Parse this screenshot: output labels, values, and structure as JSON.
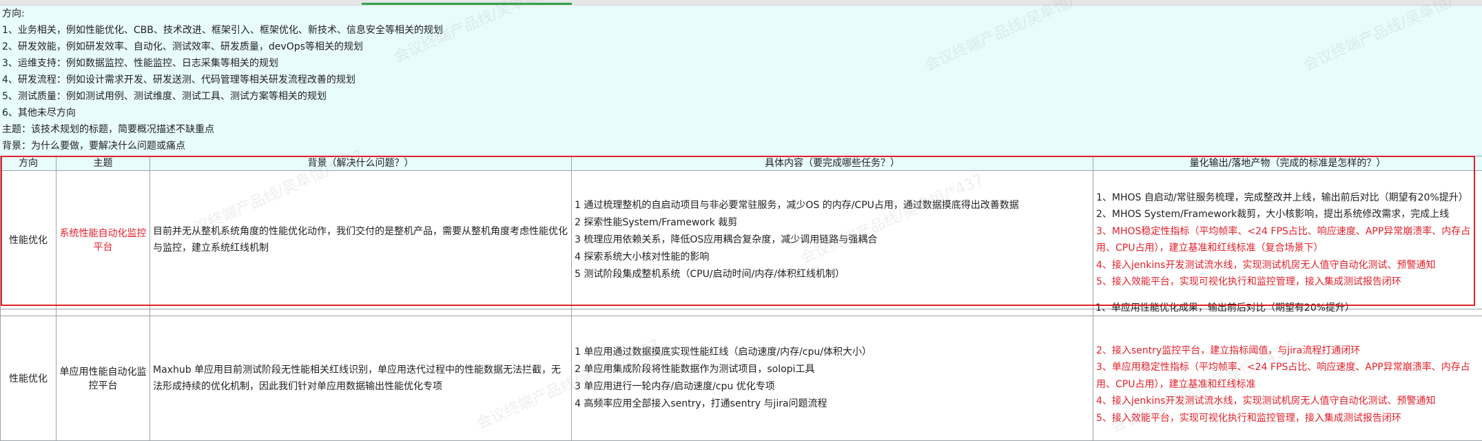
{
  "intro_lines": [
    "方向:",
    "1、业务相关，例如性能优化、CBB、技术改进、框架引入、框架优化、新技术、信息安全等相关的规划",
    "2、研发效能，例如研发效率、自动化、测试效率、研发质量，devOps等相关的规划",
    "3、运维支持：例如数据监控、性能监控、日志采集等相关的规划",
    "4、研发流程：例如设计需求开发、研发送测、代码管理等相关研发流程改善的规划",
    "5、测试质量：例如测试用例、测试维度、测试工具、测试方案等相关的规划",
    "6、其他未尽方向",
    "主题：该技术规划的标题，简要概况描述不缺重点",
    "背景：为什么要做，要解决什么问题或痛点"
  ],
  "table": {
    "headers": {
      "direction": "方向",
      "topic": "主题",
      "background": "背景（解决什么问题？）",
      "content": "具体内容（要完成哪些任务？）",
      "output": "量化输出/落地产物（完成的标准是怎样的？）"
    },
    "rows": [
      {
        "direction": "性能优化",
        "topic": "系统性能自动化监控平台",
        "background": "目前并无从整机系统角度的性能优化动作，我们交付的是整机产品，需要从整机角度考虑性能优化与监控，建立系统红线机制",
        "content": [
          "1 通过梳理整机的自启动项目与非必要常驻服务，减少OS 的内存/CPU占用，通过数据摸底得出改善数据",
          "2 探索性能System/Framework 裁剪",
          "3 梳理应用依赖关系，降低OS应用耦合复杂度，减少调用链路与强耦合",
          "4 探索系统大小核对性能的影响",
          "5 测试阶段集成整机系统（CPU/启动时间/内存/体积红线机制）"
        ],
        "output": [
          "1、MHOS 自启动/常驻服务梳理，完成整改并上线，输出前后对比（期望有20%提升）",
          "2、MHOS System/Framework裁剪，大小核影响，提出系统修改需求，完成上线",
          "3、MHOS稳定性指标（平均帧率、<24 FPS占比、响应速度、APP异常崩溃率、内存占用、CPU占用），建立基准和红线标准（复合场景下）",
          "4、接入jenkins开发测试流水线，实现测试机房无人值守自动化测试、预警通知",
          "5、接入效能平台，实现可视化执行和监控管理，接入集成测试报告闭环"
        ],
        "output_red_from": 2
      },
      {
        "direction": "性能优化",
        "topic": "单应用性能自动化监控平台",
        "background": "Maxhub 单应用目前测试阶段无性能相关红线识别，单应用迭代过程中的性能数据无法拦截，无法形成持续的优化机制，因此我们针对单应用数据输出性能优化专项",
        "content": [
          "1 单应用通过数据摸底实现性能红线（启动速度/内存/cpu/体积大小）",
          "2 单应用集成阶段将性能数据作为测试项目，solopi工具",
          "3 单应用进行一轮内存/启动速度/cpu 优化专项",
          "4 高频率应用全部接入sentry，打通sentry 与jira问题流程"
        ],
        "output_clipped_first": "1、单应用性能优化成果，输出前后对比（期望有20%提升）",
        "output": [
          "2、接入sentry监控平台，建立指标阈值，与jira流程打通闭环",
          "3、单应用稳定性指标（平均帧率、<24 FPS占比、响应速度、APP异常崩溃率、内存占用、CPU占用），建立基准和红线标准",
          "4、接入jenkins开发测试流水线，实现测试机房无人值守自动化测试、预警通知",
          "5、接入效能平台，实现可视化执行和监控管理，接入集成测试报告闭环"
        ]
      }
    ]
  },
  "watermark_text": "会议终端产品线/吴阜恒/*437",
  "colors": {
    "highlight_red": "#e0202a",
    "intro_bg": "#e8fbfd",
    "tab_green": "#2fa34a"
  }
}
